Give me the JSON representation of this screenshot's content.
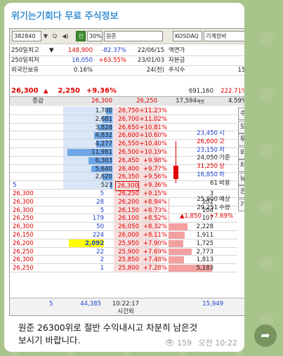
{
  "channel": {
    "title": "위기는기회다 무료 주식정보"
  },
  "toolbar": {
    "code": "382840",
    "dropdown": "▼",
    "search": "Q",
    "sound": "◀)",
    "new_label": "신",
    "pct": "30%",
    "name": "원준",
    "market": "KOSDAQ",
    "sector": "기계장비"
  },
  "info_rows": [
    {
      "label": "250일최고",
      "arrow": "▼",
      "price": "148,900",
      "rate": "-82.37%",
      "date": "22/06/15",
      "k": "액면가",
      "v": ""
    },
    {
      "label": "250일최저",
      "arrow": "",
      "price": "16,050",
      "rate": "+63.55%",
      "date": "23/01/03",
      "k": "자본금",
      "v": ""
    },
    {
      "label": "외국인보유",
      "arrow": "",
      "price": "0.16%",
      "rate": "",
      "date": "24(천)",
      "k": "주식수",
      "v": "15,"
    }
  ],
  "price_bar": {
    "price": "26,300",
    "arrow": "▲",
    "change": "2,250",
    "rate": "+9.36%",
    "volume": "691,160",
    "vol_rate": "222.71%"
  },
  "head_row": {
    "label": "증감",
    "a": "26,300",
    "b": "26,250",
    "c": "17,594",
    "c_unit": "백만",
    "d": "4.59%"
  },
  "ask_rows": [
    {
      "qty": "1,700",
      "price": "26,750",
      "rate": "+11.23%"
    },
    {
      "qty": "2,681",
      "price": "26,700",
      "rate": "+11.02%"
    },
    {
      "qty": "3,828",
      "price": "26,650",
      "rate": "+10.81%"
    },
    {
      "qty": "4,832",
      "price": "26,600",
      "rate": "+10.60%"
    },
    {
      "qty": "4,277",
      "price": "26,550",
      "rate": "+10.40%"
    },
    {
      "qty": "11,981",
      "price": "26,500",
      "rate": "+10.19%"
    },
    {
      "qty": "6,303",
      "price": "26,450",
      "rate": "+9.98%"
    },
    {
      "qty": "5,640",
      "price": "26,400",
      "rate": "+9.77%"
    },
    {
      "qty": "2,620",
      "price": "26,350",
      "rate": "+9.56%"
    },
    {
      "qty": "523",
      "price": "26,300",
      "rate": "+9.36%",
      "left": "5"
    }
  ],
  "stats": [
    {
      "v": "23,450",
      "k": "시"
    },
    {
      "v": "26,600",
      "k": "고"
    },
    {
      "v": "23,150",
      "k": "저"
    },
    {
      "v": "24,050",
      "k": "기준"
    },
    {
      "v": "31,250",
      "k": "상"
    },
    {
      "v": "16,850",
      "k": "하"
    },
    {
      "v": "61",
      "k": "비용"
    },
    {
      "v": "",
      "k": ""
    },
    {
      "v": "25,900",
      "k": "예상"
    },
    {
      "v": "29,251",
      "k": "수량"
    },
    {
      "v": "▲1,850",
      "k": "+7.69%"
    }
  ],
  "side_buttons": [
    "수",
    "도",
    "투",
    "외",
    "차",
    "뉴",
    "권",
    "기"
  ],
  "bid_rows": [
    {
      "lp": "26,300",
      "lq": "5",
      "price": "26,250",
      "rate": "+9.15%",
      "qty": "3"
    },
    {
      "lp": "26,300",
      "lq": "28",
      "price": "26,200",
      "rate": "+8.94%",
      "qty": "102"
    },
    {
      "lp": "26,300",
      "lq": "5",
      "price": "26,150",
      "rate": "+8.73%",
      "qty": "104"
    },
    {
      "lp": "26,250",
      "lq": "179",
      "price": "26,100",
      "rate": "+8.52%",
      "qty": "107"
    },
    {
      "lp": "26,300",
      "lq": "50",
      "price": "26,050",
      "rate": "+8.32%",
      "qty": "2,228"
    },
    {
      "lp": "26,150",
      "lq": "224",
      "price": "26,000",
      "rate": "+8.11%",
      "qty": "1,911"
    },
    {
      "lp": "26,200",
      "lq": "2,092",
      "price": "25,950",
      "rate": "+7.90%",
      "qty": "1,725"
    },
    {
      "lp": "26,250",
      "lq": "22",
      "price": "25,900",
      "rate": "+7.69%",
      "qty": "2,773"
    },
    {
      "lp": "26,300",
      "lq": "2",
      "price": "25,850",
      "rate": "+7.48%",
      "qty": "1,813"
    },
    {
      "lp": "26,250",
      "lq": "1",
      "price": "25,800",
      "rate": "+7.28%",
      "qty": "5,183"
    }
  ],
  "footer": {
    "left": "5",
    "ask_total": "44,385",
    "time": "10:22:17",
    "time_label": "시간외",
    "bid_total": "15,949"
  },
  "message": {
    "text": "원준 26300위로 절반 수익내시고 차분히 남은것\n보시기 바랍니다.",
    "views": "159",
    "time": "오전 10:22"
  },
  "colors": {
    "ask_bg": "#d8e6f8",
    "bid_bg": "#f8dede",
    "current_box": "#e00000",
    "highlight": "#ffff00",
    "up": "#e00000",
    "down": "#1b3fd0"
  }
}
